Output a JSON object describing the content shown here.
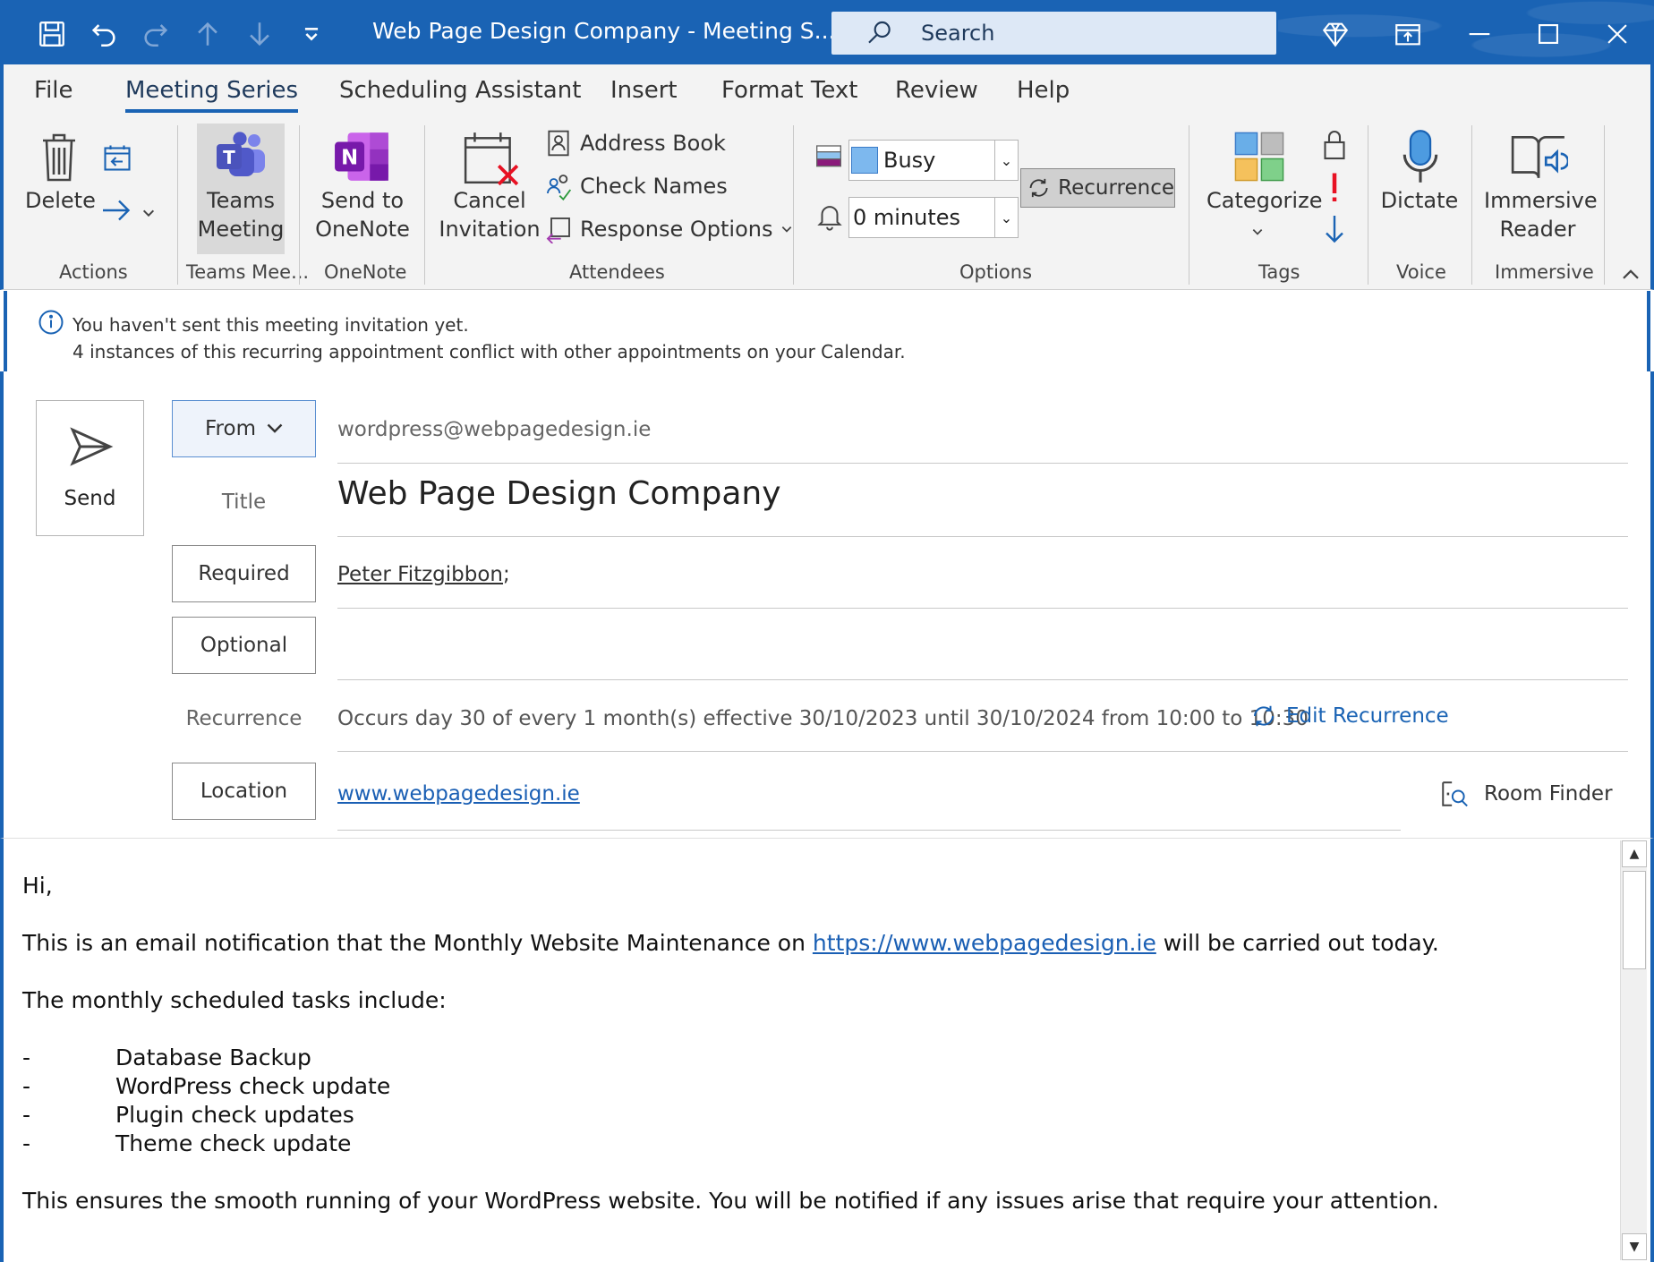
{
  "window": {
    "title": "Web Page Design Company  -  Meeting S...",
    "search_placeholder": "Search"
  },
  "tabs": [
    "File",
    "Meeting Series",
    "Scheduling Assistant",
    "Insert",
    "Format Text",
    "Review",
    "Help"
  ],
  "ribbon": {
    "actions": {
      "delete_label": "Delete",
      "group_label": "Actions"
    },
    "teams": {
      "label_line1": "Teams",
      "label_line2": "Meeting",
      "group_label": "Teams Mee..."
    },
    "onenote": {
      "label_line1": "Send to",
      "label_line2": "OneNote",
      "group_label": "OneNote"
    },
    "attendees": {
      "cancel_line1": "Cancel",
      "cancel_line2": "Invitation",
      "address_book": "Address Book",
      "check_names": "Check Names",
      "response_options": "Response Options",
      "group_label": "Attendees"
    },
    "options": {
      "show_as_value": "Busy",
      "reminder_value": "0 minutes",
      "recurrence_label": "Recurrence",
      "group_label": "Options"
    },
    "tags": {
      "categorize_label": "Categorize",
      "group_label": "Tags"
    },
    "voice": {
      "dictate_label": "Dictate",
      "group_label": "Voice"
    },
    "immersive": {
      "label_line1": "Immersive",
      "label_line2": "Reader",
      "group_label": "Immersive"
    }
  },
  "info": {
    "line1": "You haven't sent this meeting invitation yet.",
    "line2": "4 instances of this recurring appointment conflict with other appointments on your Calendar."
  },
  "form": {
    "send_label": "Send",
    "from_label": "From",
    "from_value": "wordpress@webpagedesign.ie",
    "title_label": "Title",
    "title_value": "Web Page Design Company",
    "required_label": "Required",
    "required_name": "Peter Fitzgibbon",
    "required_sep": ";",
    "optional_label": "Optional",
    "recurrence_label": "Recurrence",
    "recurrence_value": "Occurs day 30 of every 1 month(s) effective 30/10/2023 until 30/10/2024 from 10:00 to 10:30",
    "edit_recurrence": "Edit Recurrence",
    "location_label": "Location",
    "location_value": "www.webpagedesign.ie",
    "room_finder": "Room Finder"
  },
  "body": {
    "greeting": "Hi,",
    "para1_before": "This is an email notification that the Monthly Website Maintenance on ",
    "para1_link": "https://www.webpagedesign.ie",
    "para1_after": " will be carried out today.",
    "para2": "The monthly scheduled tasks include:",
    "bullet_marker": "-",
    "tasks": [
      "Database Backup",
      "WordPress check update",
      "Plugin check updates",
      "Theme check update"
    ],
    "para3": "This ensures the smooth running of your WordPress website. You will be notified if any issues arise that require your attention."
  },
  "colors": {
    "accent": "#1a63b4",
    "ribbon_bg": "#f3f3f3",
    "link": "#1a5fb4",
    "alert": "#e81123"
  }
}
